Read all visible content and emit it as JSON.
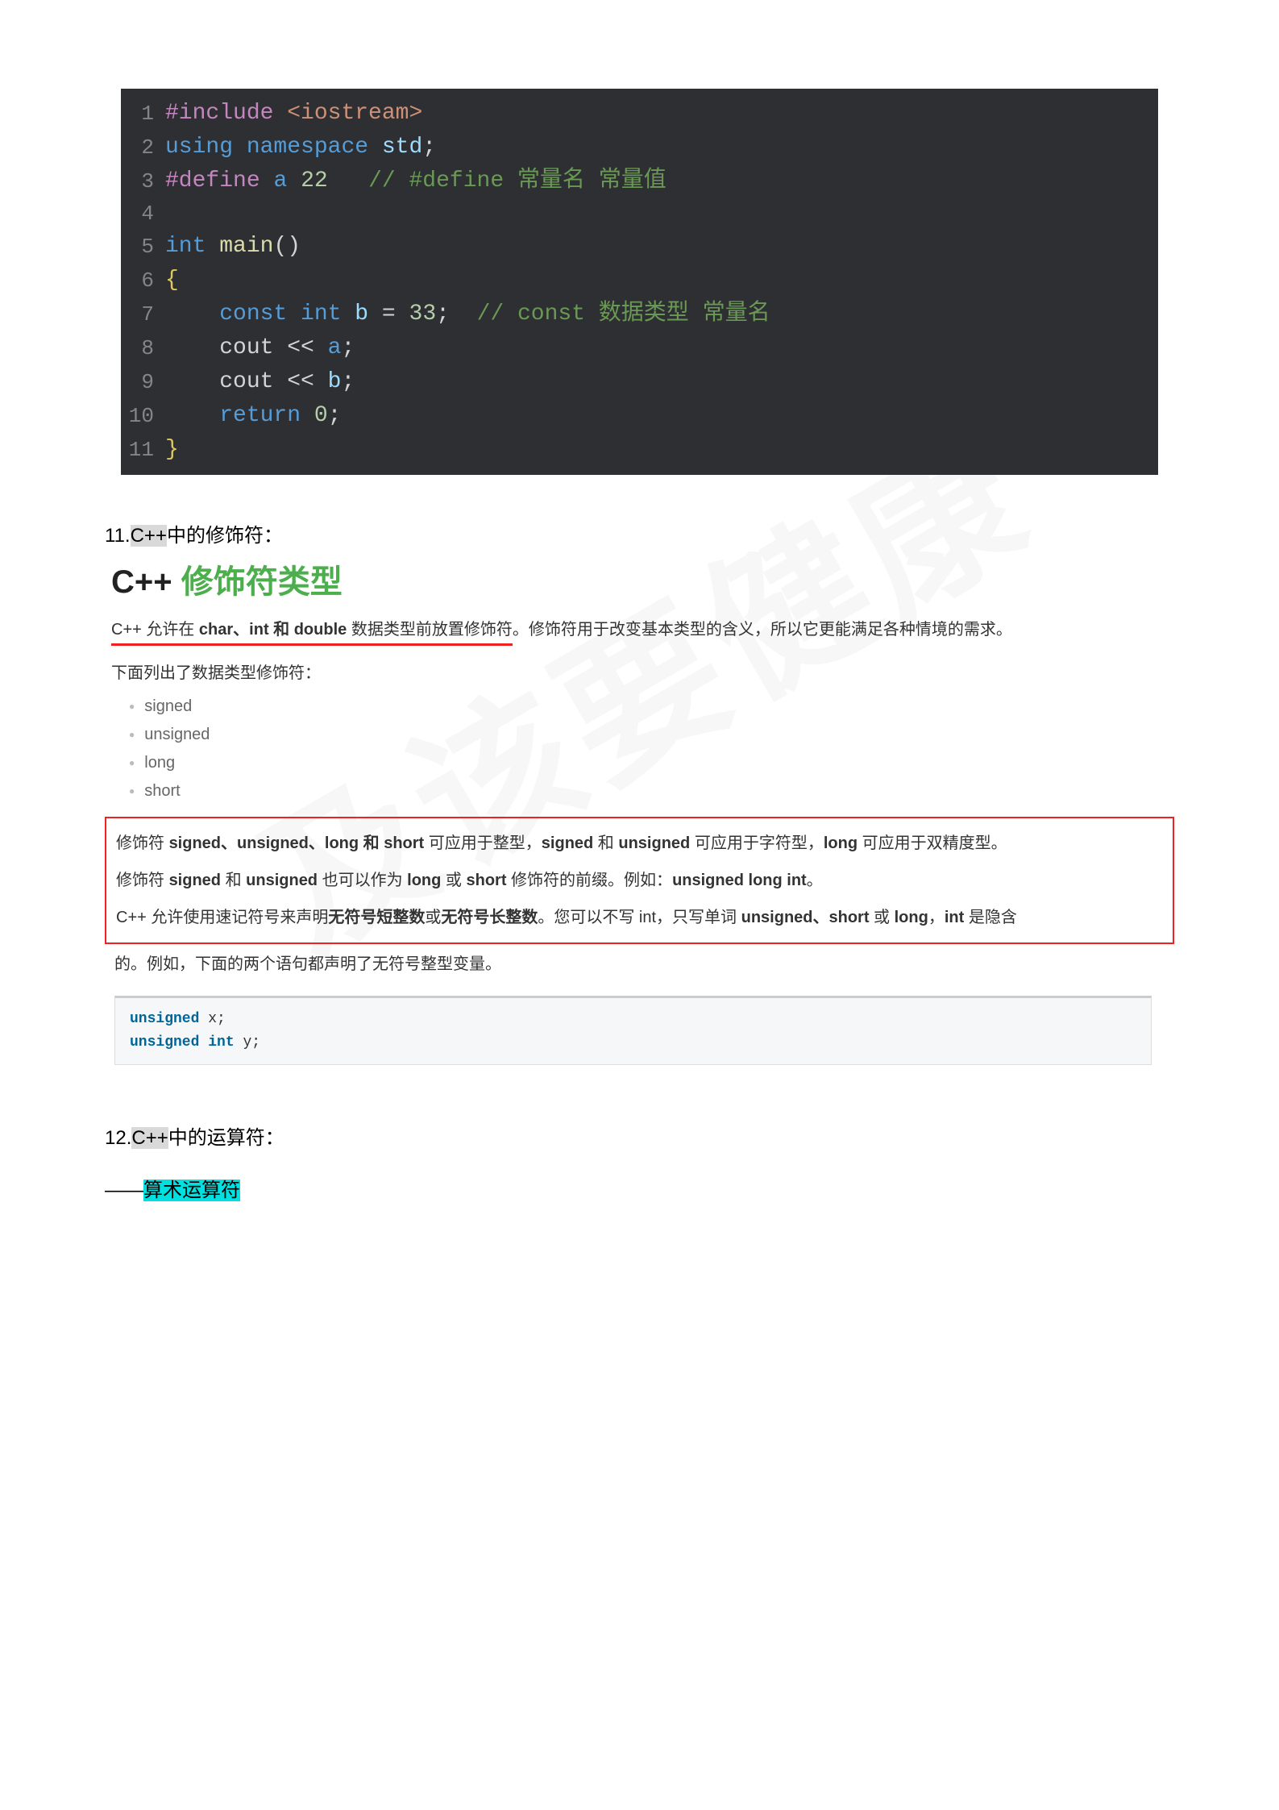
{
  "watermark": "及该要健康",
  "code_dark": {
    "lines": [
      {
        "no": "1",
        "tokens": [
          {
            "cls": "c-directive",
            "t": "#include"
          },
          {
            "cls": "c-white",
            "t": " "
          },
          {
            "cls": "c-include-str",
            "t": "<iostream>"
          }
        ]
      },
      {
        "no": "2",
        "tokens": [
          {
            "cls": "c-keyword",
            "t": "using"
          },
          {
            "cls": "c-white",
            "t": " "
          },
          {
            "cls": "c-keyword",
            "t": "namespace"
          },
          {
            "cls": "c-white",
            "t": " "
          },
          {
            "cls": "c-ident",
            "t": "std"
          },
          {
            "cls": "c-punct",
            "t": ";"
          }
        ]
      },
      {
        "no": "3",
        "tokens": [
          {
            "cls": "c-directive",
            "t": "#define"
          },
          {
            "cls": "c-white",
            "t": " "
          },
          {
            "cls": "c-macro",
            "t": "a"
          },
          {
            "cls": "c-white",
            "t": " "
          },
          {
            "cls": "c-number",
            "t": "22"
          },
          {
            "cls": "c-white",
            "t": "   "
          },
          {
            "cls": "c-comment",
            "t": "// #define 常量名 常量值"
          }
        ]
      },
      {
        "no": "4",
        "tokens": [
          {
            "cls": "c-white",
            "t": ""
          }
        ]
      },
      {
        "no": "5",
        "tokens": [
          {
            "cls": "c-type",
            "t": "int"
          },
          {
            "cls": "c-white",
            "t": " "
          },
          {
            "cls": "c-func",
            "t": "main"
          },
          {
            "cls": "c-punct",
            "t": "()"
          }
        ]
      },
      {
        "no": "6",
        "tokens": [
          {
            "cls": "c-brace",
            "t": "{"
          }
        ]
      },
      {
        "no": "7",
        "tokens": [
          {
            "cls": "c-white",
            "t": "    "
          },
          {
            "cls": "c-keyword",
            "t": "const"
          },
          {
            "cls": "c-white",
            "t": " "
          },
          {
            "cls": "c-type",
            "t": "int"
          },
          {
            "cls": "c-white",
            "t": " "
          },
          {
            "cls": "c-ident",
            "t": "b"
          },
          {
            "cls": "c-white",
            "t": " "
          },
          {
            "cls": "c-punct",
            "t": "="
          },
          {
            "cls": "c-white",
            "t": " "
          },
          {
            "cls": "c-number",
            "t": "33"
          },
          {
            "cls": "c-punct",
            "t": ";"
          },
          {
            "cls": "c-white",
            "t": "  "
          },
          {
            "cls": "c-comment",
            "t": "// const 数据类型 常量名"
          }
        ]
      },
      {
        "no": "8",
        "tokens": [
          {
            "cls": "c-white",
            "t": "    "
          },
          {
            "cls": "c-cout",
            "t": "cout"
          },
          {
            "cls": "c-white",
            "t": " "
          },
          {
            "cls": "c-punct",
            "t": "<<"
          },
          {
            "cls": "c-white",
            "t": " "
          },
          {
            "cls": "c-macro",
            "t": "a"
          },
          {
            "cls": "c-punct",
            "t": ";"
          }
        ]
      },
      {
        "no": "9",
        "tokens": [
          {
            "cls": "c-white",
            "t": "    "
          },
          {
            "cls": "c-cout",
            "t": "cout"
          },
          {
            "cls": "c-white",
            "t": " "
          },
          {
            "cls": "c-punct",
            "t": "<<"
          },
          {
            "cls": "c-white",
            "t": " "
          },
          {
            "cls": "c-ident",
            "t": "b"
          },
          {
            "cls": "c-punct",
            "t": ";"
          }
        ]
      },
      {
        "no": "10",
        "tokens": [
          {
            "cls": "c-white",
            "t": "    "
          },
          {
            "cls": "c-keyword",
            "t": "return"
          },
          {
            "cls": "c-white",
            "t": " "
          },
          {
            "cls": "c-number",
            "t": "0"
          },
          {
            "cls": "c-punct",
            "t": ";"
          }
        ]
      },
      {
        "no": "11",
        "tokens": [
          {
            "cls": "c-brace",
            "t": "}"
          }
        ]
      }
    ]
  },
  "sec11": {
    "label_prefix": "11.",
    "label_hl": "C++",
    "label_suffix": "中的修饰符：",
    "title_prefix": "C++ ",
    "title_green": "修饰符类型",
    "p1_underlined_pre": "C++ 允许在 ",
    "p1_underlined_bold": "char、int 和 double",
    "p1_underlined_post": " 数据类型前放置修饰符",
    "p1_rest": "。修饰符用于改变基本类型的含义，所以它更能满足各种情境的需求。",
    "p2": "下面列出了数据类型修饰符：",
    "modifiers": [
      "signed",
      "unsigned",
      "long",
      "short"
    ],
    "redbox_p1_a": "修饰符 ",
    "redbox_p1_b1": "signed、unsigned、long 和 short",
    "redbox_p1_c": " 可应用于整型，",
    "redbox_p1_b2": "signed",
    "redbox_p1_d": " 和 ",
    "redbox_p1_b3": "unsigned",
    "redbox_p1_e": " 可应用于字符型，",
    "redbox_p1_b4": "long",
    "redbox_p1_f": " 可应用于双精度型。",
    "redbox_p2_a": "修饰符 ",
    "redbox_p2_b1": "signed",
    "redbox_p2_c": " 和 ",
    "redbox_p2_b2": "unsigned",
    "redbox_p2_d": " 也可以作为 ",
    "redbox_p2_b3": "long",
    "redbox_p2_e": " 或 ",
    "redbox_p2_b4": "short",
    "redbox_p2_f": " 修饰符的前缀。例如：",
    "redbox_p2_b5": "unsigned long int",
    "redbox_p2_g": "。",
    "redbox_p3_a": "C++ 允许使用速记符号来声明",
    "redbox_p3_b1": "无符号短整数",
    "redbox_p3_c": "或",
    "redbox_p3_b2": "无符号长整数",
    "redbox_p3_d": "。您可以不写 int，只写单词 ",
    "redbox_p3_b3": "unsigned、short",
    "redbox_p3_e": " 或 ",
    "redbox_p3_b4": "long",
    "redbox_p3_f": "，",
    "redbox_p3_b5": "int",
    "redbox_p3_g": " 是隐含",
    "after_redbox": "的。例如，下面的两个语句都声明了无符号整型变量。"
  },
  "code_light": {
    "l1_kw": "unsigned",
    "l1_rest": " x;",
    "l2_kw1": "unsigned",
    "l2_kw2": "int",
    "l2_rest": " y;"
  },
  "sec12": {
    "label_prefix": "12.",
    "label_hl": "C++",
    "label_suffix": "中的运算符：",
    "dash": "——",
    "arith_hl": "算术运算符"
  }
}
